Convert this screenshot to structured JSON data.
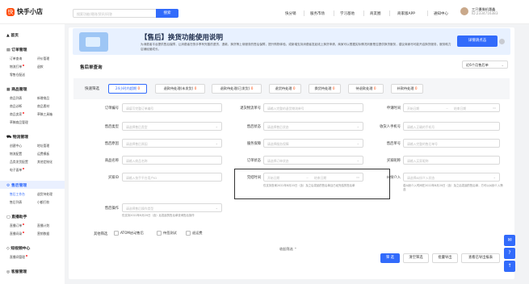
{
  "app": {
    "logo_mark": "快",
    "name": "快手小店"
  },
  "search": {
    "placeholder": "搜索功能/规则/资讯/问答",
    "button": "搜索"
  },
  "topnav": [
    "快分销",
    "服务市场",
    "学习基地",
    "商友圈",
    "商家版APP",
    "通知中心"
  ],
  "user": {
    "name": "三只摄像机惠鑫",
    "id": "ID:2334716383"
  },
  "sidebar": {
    "home": "首页",
    "sections": [
      {
        "title": "订单管理",
        "items": [
          "订单查询",
          "评价管理",
          "物流打单",
          "退款",
          "零售仓配送"
        ]
      },
      {
        "title": "商品管理",
        "items": [
          "商品列表",
          "新增商品",
          "商品诊断",
          "商品素材",
          "商品卖家",
          "草稿工具箱",
          "草稿商品管理"
        ]
      },
      {
        "title": "物流管理",
        "items": [
          "创建中心",
          "地址管理",
          "物流配置",
          "运费模板",
          "品类发货配置",
          "其他定制化",
          "电子面单"
        ]
      },
      {
        "title": "售后管理",
        "items": [
          "售后工作台",
          "退货待处理",
          "售后列表",
          "小额打款"
        ]
      },
      {
        "title": "直播助手",
        "items": [
          "直播订单",
          "直播计划",
          "直播间录",
          "营销数据"
        ]
      },
      {
        "title": "短视频中心",
        "items": [
          "直播间管理"
        ]
      },
      {
        "title": "客服管理",
        "items": []
      }
    ]
  },
  "banner": {
    "title": "【售后】换货功能使用说明",
    "body": "为消费者平台提供售后保障，让消费者在快手享有完善的退货、退款、换货等上帝服务的售后保障，提升购物体验，或新增支持消费者发起线上换货申请，商家可以根据实际情况判断是否提供换货服务，建议商家尽可能开启换货服务，服务助力店铺经营成长。",
    "detail_button": "详情请点击"
  },
  "page": {
    "title": "售后单查询",
    "date_range": "近6个月售后单"
  },
  "quick_filter": {
    "label": "快速筛选",
    "tabs": [
      {
        "label": "24小时内超期",
        "count": "0"
      },
      {
        "label": "退款待处理(未发货)",
        "count": "0"
      },
      {
        "label": "退款待处理(已发货)",
        "count": "0"
      },
      {
        "label": "退货待处理",
        "count": "0"
      },
      {
        "label": "换货待处理",
        "count": "0"
      },
      {
        "label": "待退款处理",
        "count": "0"
      },
      {
        "label": "补款待处理",
        "count": "0"
      }
    ]
  },
  "form": {
    "order_no": {
      "label": "订单编号",
      "placeholder": "请填写完整订单编号"
    },
    "return_tracking": {
      "label": "退货物流单号",
      "placeholder": "请输入完整的退货物流单号"
    },
    "apply_time": {
      "label": "申请时间",
      "start": "开始日期",
      "end": "结束日期"
    },
    "aftersale_type": {
      "label": "售后类型",
      "placeholder": "请选择售后类型"
    },
    "aftersale_status": {
      "label": "售后状态",
      "placeholder": "请选择售后状态"
    },
    "receiver_phone": {
      "label": "收货人手机号",
      "placeholder": "请输入正确的手机号"
    },
    "aftersale_reason": {
      "label": "售后原因",
      "placeholder": "请选择售后原因"
    },
    "service_guarantee": {
      "label": "服务保障",
      "placeholder": "请选择服务保障"
    },
    "aftersale_no": {
      "label": "售后单号",
      "placeholder": "请输入完整的售后单号"
    },
    "product_name": {
      "label": "商品名称",
      "placeholder": "请输入商品名称"
    },
    "order_status": {
      "label": "订单状态",
      "placeholder": "请选择订单状态"
    },
    "buyer_nick": {
      "label": "买家昵称",
      "placeholder": "请输入买家昵称"
    },
    "buyer_id": {
      "label": "买家ID",
      "placeholder": "请输入快手平台用户ID"
    },
    "complete_time": {
      "label": "完结时间",
      "start": "开始日期",
      "end": "结束日期",
      "hint": "仅支持查询2022年8月20日（含）及之后发起的售后单且已经完结的售后单"
    },
    "dispute": {
      "label": "纠纷介入",
      "placeholder": "请选择纠纷介入状态",
      "hint": "若纠纷介入时间在2022年8月20日（含）及之后发起的售后单，方可以纠纷介入筛选"
    },
    "aftersale_action": {
      "label": "售后操作",
      "placeholder": "请选择售后操作类型",
      "hint": "仅支持2022年8月20日（含）后发起的售后单查询售后操作"
    }
  },
  "other_filters": {
    "label": "其他筛选",
    "options": [
      "ATOM启动售后",
      "待签测试",
      "退运费"
    ]
  },
  "collapse": "收起筛选",
  "actions": {
    "filter": "筛 选",
    "reset": "清空筛选",
    "batch_export": "批量导出",
    "view_exports": "查看已导出报表"
  },
  "floating": [
    "✉",
    "?",
    "↑"
  ]
}
